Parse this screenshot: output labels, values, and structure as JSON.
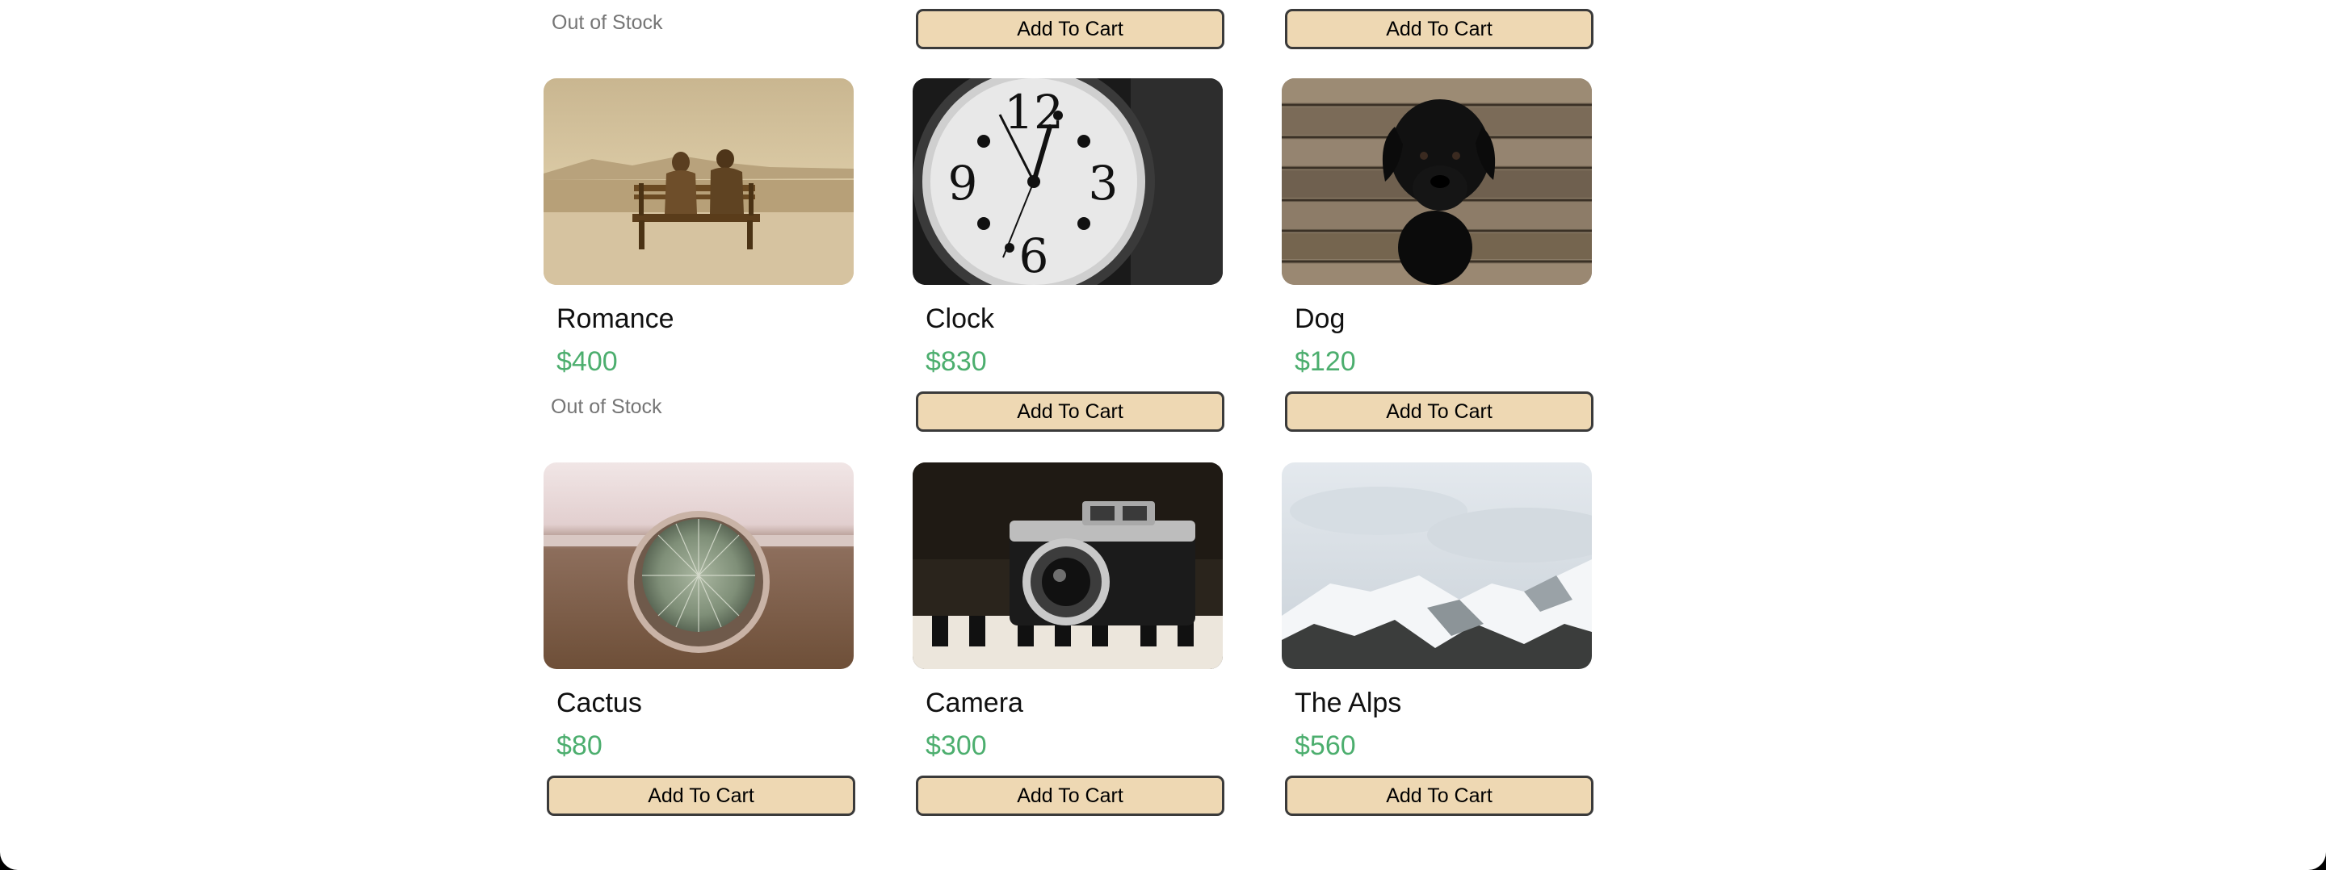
{
  "top_row": {
    "stock_text": "Out of Stock",
    "button_b": "Add To Cart",
    "button_c": "Add To Cart"
  },
  "products": [
    {
      "name": "Romance",
      "price": "$400",
      "stock_text": "Out of Stock",
      "image": "couple-on-bench-image"
    },
    {
      "name": "Clock",
      "price": "$830",
      "button": "Add To Cart",
      "image": "wall-clock-image"
    },
    {
      "name": "Dog",
      "price": "$120",
      "button": "Add To Cart",
      "image": "black-puppy-image"
    },
    {
      "name": "Cactus",
      "price": "$80",
      "button": "Add To Cart",
      "image": "cactus-pot-image"
    },
    {
      "name": "Camera",
      "price": "$300",
      "button": "Add To Cart",
      "image": "vintage-camera-image"
    },
    {
      "name": "The Alps",
      "price": "$560",
      "button": "Add To Cart",
      "image": "snowy-mountains-image"
    }
  ],
  "colors": {
    "price": "#4cae6e",
    "button_bg": "#eed8b3",
    "button_border": "#3a3a3a",
    "stock_text": "#757575"
  }
}
